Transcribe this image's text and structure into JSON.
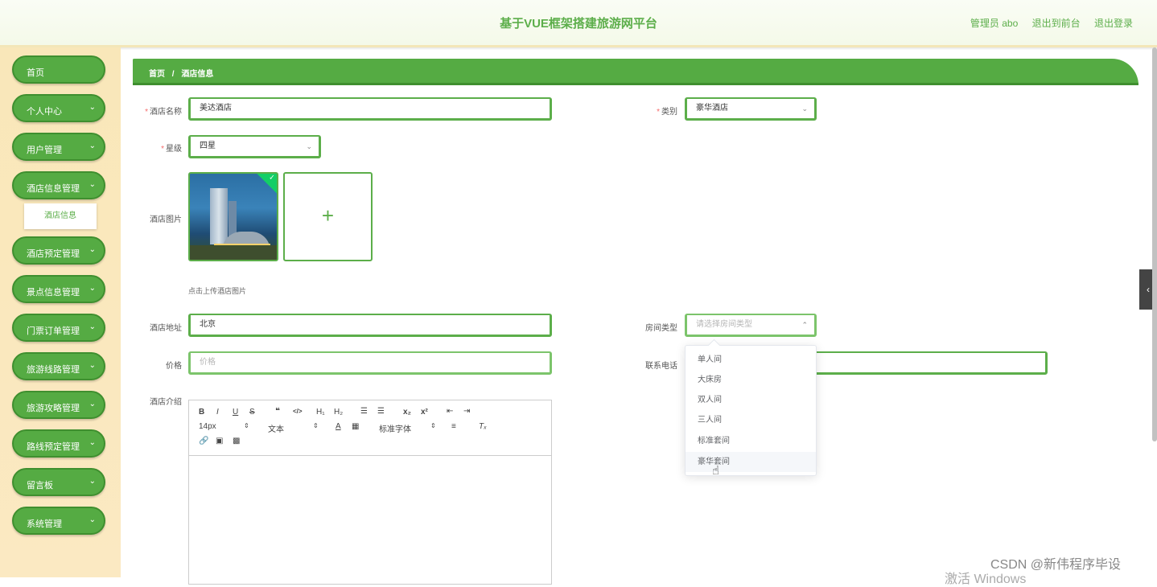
{
  "header": {
    "title": "基于VUE框架搭建旅游网平台",
    "admin": "管理员 abo",
    "front": "退出到前台",
    "logout": "退出登录"
  },
  "sidebar": {
    "items": [
      {
        "label": "首页",
        "has_children": false
      },
      {
        "label": "个人中心",
        "has_children": true
      },
      {
        "label": "用户管理",
        "has_children": true
      },
      {
        "label": "酒店信息管理",
        "has_children": true,
        "expanded": true
      },
      {
        "label": "酒店预定管理",
        "has_children": true
      },
      {
        "label": "景点信息管理",
        "has_children": true
      },
      {
        "label": "门票订单管理",
        "has_children": true
      },
      {
        "label": "旅游线路管理",
        "has_children": true
      },
      {
        "label": "旅游攻略管理",
        "has_children": true
      },
      {
        "label": "路线预定管理",
        "has_children": true
      },
      {
        "label": "留言板",
        "has_children": true
      },
      {
        "label": "系统管理",
        "has_children": true
      }
    ],
    "submenu": "酒店信息"
  },
  "breadcrumb": {
    "home": "首页",
    "sep": "/",
    "current": "酒店信息"
  },
  "form": {
    "hotel_name": {
      "label": "酒店名称",
      "value": "美达酒店",
      "required": true
    },
    "category": {
      "label": "类别",
      "value": "豪华酒店",
      "required": true
    },
    "star": {
      "label": "星级",
      "value": "四星",
      "required": true
    },
    "image": {
      "label": "酒店图片",
      "tip": "点击上传酒店图片"
    },
    "address": {
      "label": "酒店地址",
      "value": "北京"
    },
    "room_type": {
      "label": "房间类型",
      "placeholder": "请选择房间类型"
    },
    "price": {
      "label": "价格",
      "placeholder": "价格"
    },
    "phone": {
      "label": "联系电话"
    },
    "intro": {
      "label": "酒店介绍"
    }
  },
  "editor": {
    "font_size": "14px",
    "text": "文本",
    "font": "标准字体"
  },
  "room_options": [
    "单人间",
    "大床房",
    "双人间",
    "三人间",
    "标准套间",
    "豪华套间"
  ],
  "watermark": "CSDN @新伟程序毕设",
  "activate": "激活 Windows",
  "colors": {
    "accent": "#55ab43",
    "accent_dark": "#3f8f2f",
    "sidebar_bg": "#f9e7b9",
    "required": "#f56c6c"
  }
}
